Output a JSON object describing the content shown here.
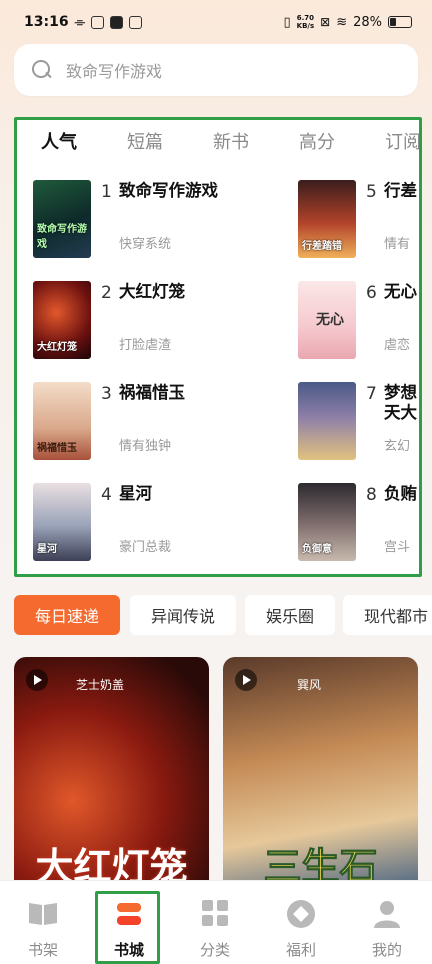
{
  "status_bar": {
    "time": "13:16",
    "net_speed_value": "6.70",
    "net_speed_unit": "KB/s",
    "battery": "28%",
    "accent": "#111111"
  },
  "search": {
    "placeholder": "致命写作游戏"
  },
  "ranking": {
    "tabs": [
      "人气",
      "短篇",
      "新书",
      "高分",
      "订阅"
    ],
    "active_tab": "人气",
    "books": [
      {
        "rank": "1",
        "title": "致命写作游戏",
        "tag": "快穿系统",
        "cover_text": "致命写作游戏"
      },
      {
        "rank": "2",
        "title": "大红灯笼",
        "tag": "打脸虐渣",
        "cover_text": "大红灯笼"
      },
      {
        "rank": "3",
        "title": "祸福惜玉",
        "tag": "情有独钟",
        "cover_text": "祸福惜玉"
      },
      {
        "rank": "4",
        "title": "星河",
        "tag": "豪门总裁",
        "cover_text": "星河"
      },
      {
        "rank": "5",
        "title": "行差",
        "tag": "情有",
        "cover_text": "行差踏错"
      },
      {
        "rank": "6",
        "title": "无心",
        "tag": "虐恋",
        "cover_text": "无心"
      },
      {
        "rank": "7",
        "title": "梦想\n天大",
        "tag": "玄幻",
        "cover_text": ""
      },
      {
        "rank": "8",
        "title": "负贿",
        "tag": "宫斗",
        "cover_text": "负御意"
      }
    ],
    "highlight_color": "#2f9e46"
  },
  "chips": [
    "每日速递",
    "异闻传说",
    "娱乐圈",
    "现代都市"
  ],
  "chips_active_color": "#f56a2e",
  "video_cards": [
    {
      "author": "芝士奶盖",
      "title": "大红灯笼"
    },
    {
      "author": "巽风",
      "title": "三生石"
    }
  ],
  "bottom_nav": {
    "items": [
      {
        "label": "书架",
        "icon": "bookshelf-icon"
      },
      {
        "label": "书城",
        "icon": "bookstore-icon"
      },
      {
        "label": "分类",
        "icon": "category-grid-icon"
      },
      {
        "label": "福利",
        "icon": "welfare-icon"
      },
      {
        "label": "我的",
        "icon": "profile-icon"
      }
    ],
    "active": "书城"
  }
}
